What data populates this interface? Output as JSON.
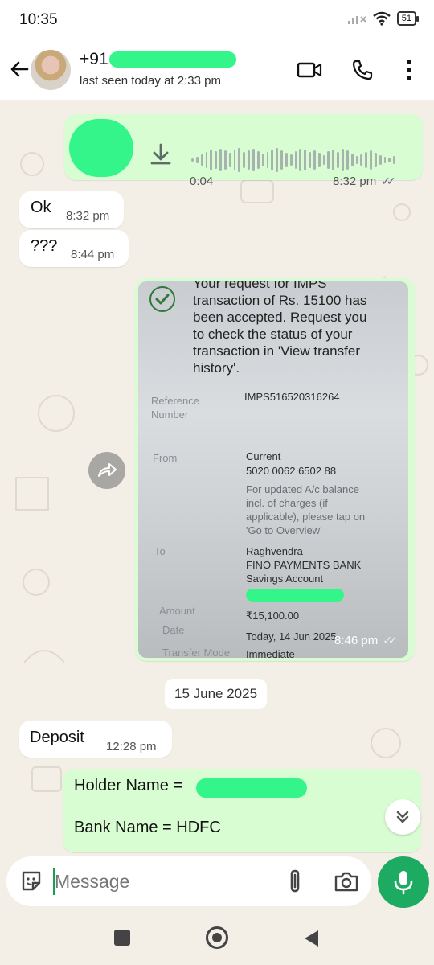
{
  "status_bar": {
    "time": "10:35",
    "battery": "51"
  },
  "header": {
    "contact_prefix": "+91",
    "last_seen": "last seen today at 2:33 pm"
  },
  "messages": {
    "voice": {
      "duration": "0:04",
      "time": "8:32 pm"
    },
    "ok": {
      "text": "Ok",
      "time": "8:32 pm"
    },
    "qqq": {
      "text": "???",
      "time": "8:44 pm"
    },
    "image": {
      "time": "8:46 pm",
      "shot": {
        "heading_partial": "Your request for IMPS",
        "lines": [
          "transaction of Rs. 15100 has",
          "been accepted. Request you",
          "to check the status of your",
          "transaction in 'View transfer",
          "history'."
        ],
        "ref_label": "Reference Number",
        "ref_value": "IMPS516520316264",
        "from_label": "From",
        "from_type": "Current",
        "from_acct": "5020 0062 6502 88",
        "from_note": [
          "For updated A/c balance",
          "incl. of charges (if",
          "applicable), please tap on",
          "'Go to Overview'"
        ],
        "to_label": "To",
        "to_name": "Raghvendra",
        "to_bank": "FINO PAYMENTS BANK",
        "to_type": "Savings Account",
        "amount_label": "Amount",
        "amount_value": "₹15,100.00",
        "date_label": "Date",
        "date_value": "Today, 14 Jun 2025",
        "mode_label": "Transfer Mode",
        "mode_value": "Immediate"
      }
    },
    "date_divider": "15 June 2025",
    "deposit": {
      "text": "Deposit",
      "time": "12:28 pm"
    },
    "holder": {
      "line1": "Holder Name = ",
      "line2": "Bank Name = HDFC"
    }
  },
  "composer": {
    "placeholder": "Message"
  },
  "icons": {
    "back": "back-arrow-icon",
    "video": "video-call-icon",
    "phone": "voice-call-icon",
    "menu": "more-vert-icon",
    "download": "download-icon",
    "forward": "forward-icon",
    "scroll": "double-chevron-down-icon",
    "sticker": "sticker-icon",
    "attach": "paperclip-icon",
    "camera": "camera-icon",
    "mic": "mic-icon"
  },
  "colors": {
    "outgoing_bubble": "#d9fdd3",
    "accent": "#1daa61",
    "redaction": "#34f58a"
  }
}
